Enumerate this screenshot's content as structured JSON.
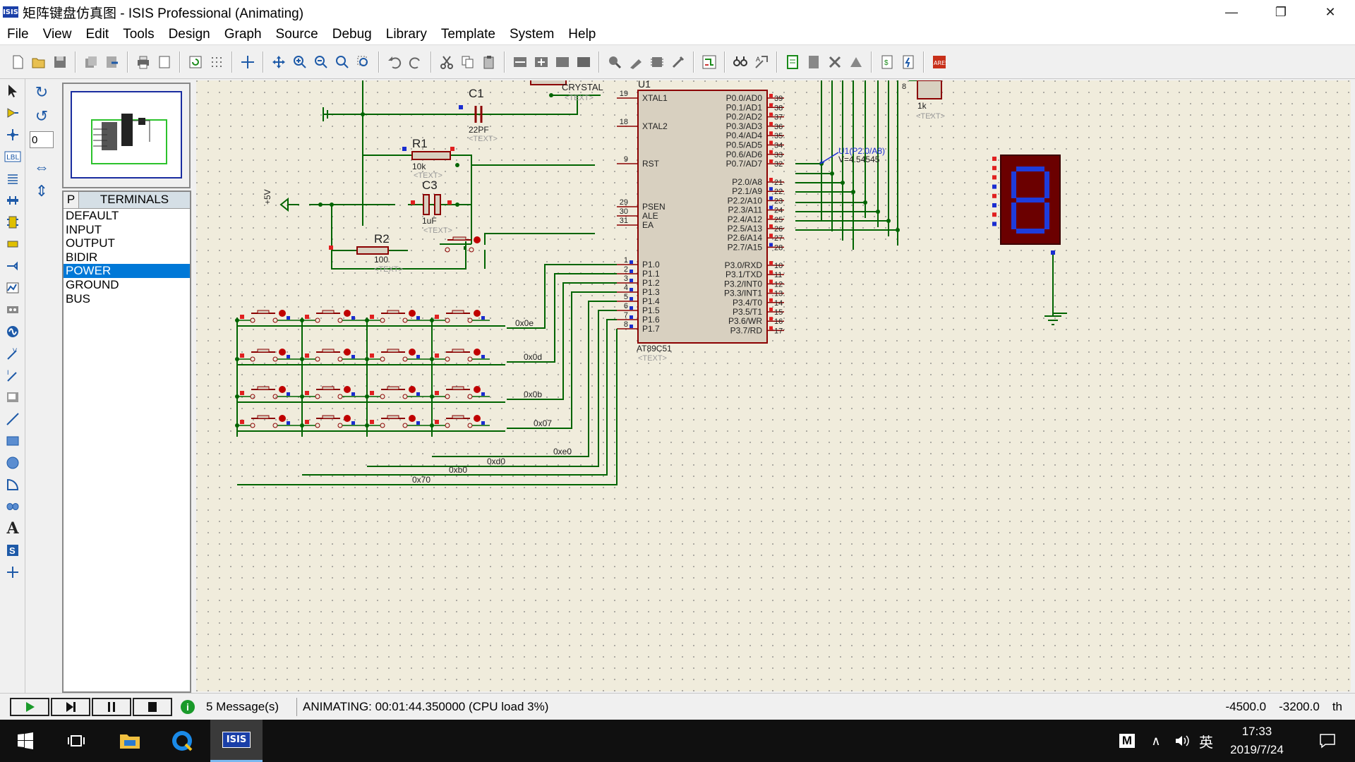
{
  "window": {
    "title": "矩阵键盘仿真图 - ISIS Professional (Animating)",
    "icon_text": "ISIS",
    "minimize_icon": "minimize-icon",
    "maximize_icon": "restore-icon",
    "close_icon": "close-icon"
  },
  "menu": [
    "File",
    "View",
    "Edit",
    "Tools",
    "Design",
    "Graph",
    "Source",
    "Debug",
    "Library",
    "Template",
    "System",
    "Help"
  ],
  "rotation_value": "0",
  "terminals": {
    "tab": "P",
    "title": "TERMINALS",
    "items": [
      "DEFAULT",
      "INPUT",
      "OUTPUT",
      "BIDIR",
      "POWER",
      "GROUND",
      "BUS"
    ],
    "selected": "POWER"
  },
  "schematic": {
    "c1": {
      "ref": "C1",
      "value": "22PF",
      "text": "<TEXT>"
    },
    "r1": {
      "ref": "R1",
      "value": "10k",
      "text": "<TEXT>"
    },
    "c3": {
      "ref": "C3",
      "value": "1uF",
      "text": "<TEXT>"
    },
    "r2": {
      "ref": "R2",
      "value": "100",
      "text": "<TEXT>"
    },
    "crystal": {
      "label": "CRYSTAL",
      "text": "<TEXT>"
    },
    "pullup": {
      "value": "1k",
      "text": "<TEXT>",
      "pin": "8"
    },
    "power_label": "+5V",
    "probe": {
      "label": "U1(P2.0/A8)",
      "value": "V=4.54545"
    },
    "u1": {
      "ref": "U1",
      "part": "AT89C51",
      "text": "<TEXT>",
      "left_pins": [
        {
          "num": "19",
          "name": "XTAL1"
        },
        {
          "num": "18",
          "name": "XTAL2"
        },
        {
          "num": "9",
          "name": "RST"
        },
        {
          "num": "29",
          "name": "PSEN"
        },
        {
          "num": "30",
          "name": "ALE"
        },
        {
          "num": "31",
          "name": "EA"
        },
        {
          "num": "1",
          "name": "P1.0"
        },
        {
          "num": "2",
          "name": "P1.1"
        },
        {
          "num": "3",
          "name": "P1.2"
        },
        {
          "num": "4",
          "name": "P1.3"
        },
        {
          "num": "5",
          "name": "P1.4"
        },
        {
          "num": "6",
          "name": "P1.5"
        },
        {
          "num": "7",
          "name": "P1.6"
        },
        {
          "num": "8",
          "name": "P1.7"
        }
      ],
      "right_pins": [
        {
          "num": "39",
          "name": "P0.0/AD0"
        },
        {
          "num": "38",
          "name": "P0.1/AD1"
        },
        {
          "num": "37",
          "name": "P0.2/AD2"
        },
        {
          "num": "36",
          "name": "P0.3/AD3"
        },
        {
          "num": "35",
          "name": "P0.4/AD4"
        },
        {
          "num": "34",
          "name": "P0.5/AD5"
        },
        {
          "num": "33",
          "name": "P0.6/AD6"
        },
        {
          "num": "32",
          "name": "P0.7/AD7"
        },
        {
          "num": "21",
          "name": "P2.0/A8"
        },
        {
          "num": "22",
          "name": "P2.1/A9"
        },
        {
          "num": "23",
          "name": "P2.2/A10"
        },
        {
          "num": "24",
          "name": "P2.3/A11"
        },
        {
          "num": "25",
          "name": "P2.4/A12"
        },
        {
          "num": "26",
          "name": "P2.5/A13"
        },
        {
          "num": "27",
          "name": "P2.6/A14"
        },
        {
          "num": "28",
          "name": "P2.7/A15"
        },
        {
          "num": "10",
          "name": "P3.0/RXD"
        },
        {
          "num": "11",
          "name": "P3.1/TXD"
        },
        {
          "num": "12",
          "name": "P3.2/INT0"
        },
        {
          "num": "13",
          "name": "P3.3/INT1"
        },
        {
          "num": "14",
          "name": "P3.4/T0"
        },
        {
          "num": "15",
          "name": "P3.5/T1"
        },
        {
          "num": "16",
          "name": "P3.6/WR"
        },
        {
          "num": "17",
          "name": "P3.7/RD"
        }
      ]
    },
    "net_labels": [
      "0x0e",
      "0x0d",
      "0x0b",
      "0x07",
      "0xe0",
      "0xd0",
      "0xb0",
      "0x70"
    ],
    "display_digit": "8"
  },
  "status": {
    "messages": "5 Message(s)",
    "animating": "ANIMATING: 00:01:44.350000 (CPU load 3%)",
    "coord_x": "-4500.0",
    "coord_y": "-3200.0",
    "units": "th"
  },
  "taskbar": {
    "time": "17:33",
    "date": "2019/7/24",
    "ime": "英",
    "ime_m": "M",
    "active_app": "ISIS"
  },
  "colors": {
    "wire": "#006400",
    "component": "#8b0000",
    "chip_fill": "#d8d0c0",
    "canvas": "#f0ecdc",
    "display_bg": "#6b0000",
    "display_seg": "#1e3cdc"
  }
}
